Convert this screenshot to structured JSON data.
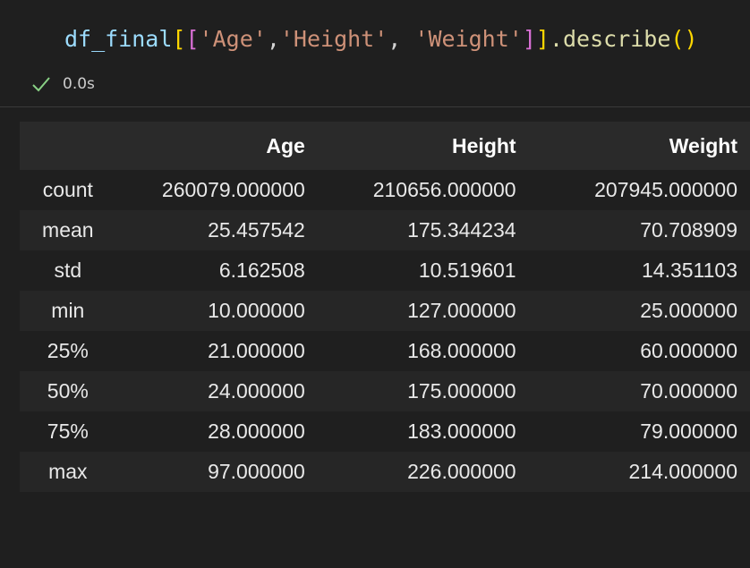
{
  "cell": {
    "code_tokens": {
      "var": "df_final",
      "open1": "[",
      "open2": "[",
      "s1": "'Age'",
      "comma1": ",",
      "s2": "'Height'",
      "comma2": ", ",
      "s3": "'Weight'",
      "close2": "]",
      "close1": "]",
      "method": ".describe",
      "parens": "()"
    },
    "status": {
      "check_icon": "check-icon",
      "exec_time": "0.0s",
      "check_color": "#89d185"
    }
  },
  "table": {
    "columns": [
      "",
      "Age",
      "Height",
      "Weight"
    ],
    "rows": [
      {
        "index": "count",
        "values": [
          "260079.000000",
          "210656.000000",
          "207945.000000"
        ]
      },
      {
        "index": "mean",
        "values": [
          "25.457542",
          "175.344234",
          "70.708909"
        ]
      },
      {
        "index": "std",
        "values": [
          "6.162508",
          "10.519601",
          "14.351103"
        ]
      },
      {
        "index": "min",
        "values": [
          "10.000000",
          "127.000000",
          "25.000000"
        ]
      },
      {
        "index": "25%",
        "values": [
          "21.000000",
          "168.000000",
          "60.000000"
        ]
      },
      {
        "index": "50%",
        "values": [
          "24.000000",
          "175.000000",
          "70.000000"
        ]
      },
      {
        "index": "75%",
        "values": [
          "28.000000",
          "183.000000",
          "79.000000"
        ]
      },
      {
        "index": "max",
        "values": [
          "97.000000",
          "226.000000",
          "214.000000"
        ]
      }
    ]
  }
}
